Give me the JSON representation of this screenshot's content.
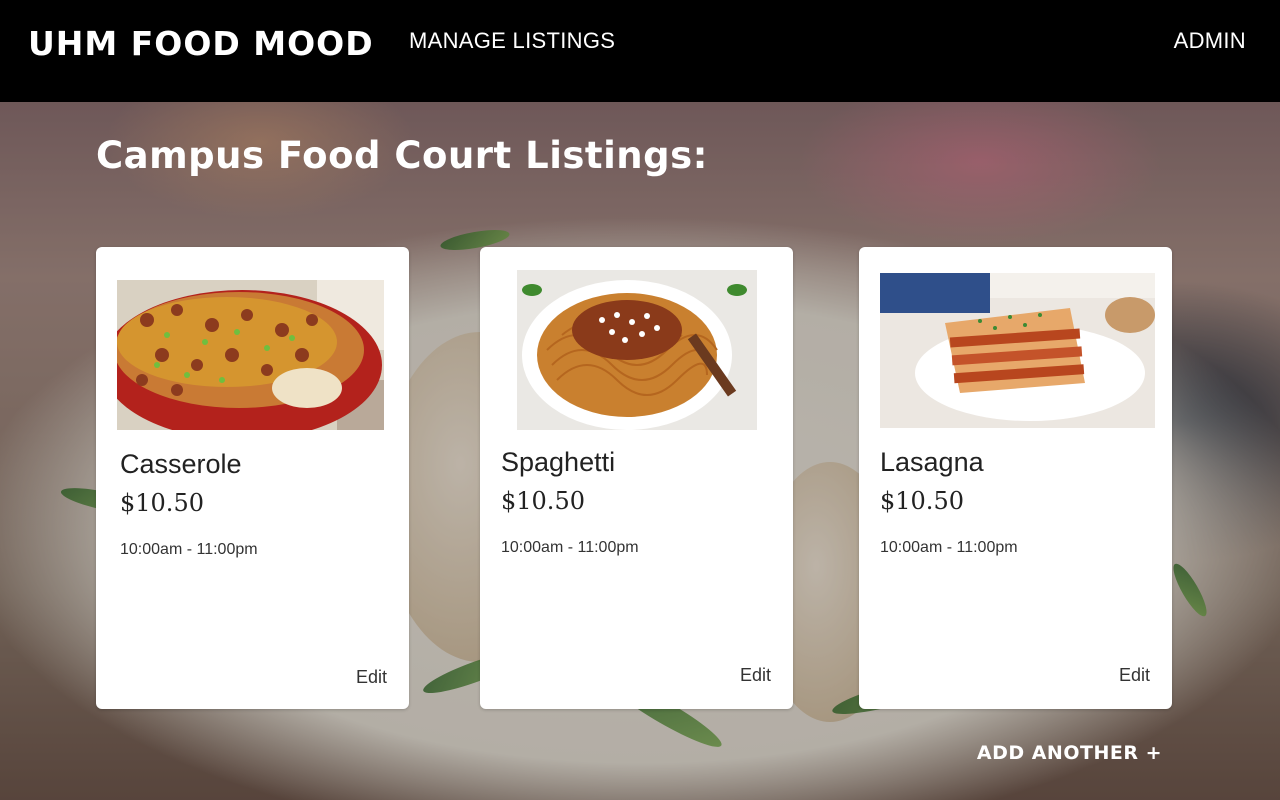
{
  "navbar": {
    "brand": "UHM FOOD MOOD",
    "manage_listings": "MANAGE LISTINGS",
    "admin": "ADMIN"
  },
  "page": {
    "title": "Campus Food Court Listings:"
  },
  "listings": [
    {
      "name": "Casserole",
      "price": "$10.50",
      "hours": "10:00am - 11:00pm",
      "edit_label": "Edit",
      "image": "casserole-photo"
    },
    {
      "name": "Spaghetti",
      "price": "$10.50",
      "hours": "10:00am - 11:00pm",
      "edit_label": "Edit",
      "image": "spaghetti-photo"
    },
    {
      "name": "Lasagna",
      "price": "$10.50",
      "hours": "10:00am - 11:00pm",
      "edit_label": "Edit",
      "image": "lasagna-photo"
    }
  ],
  "actions": {
    "add_another": "ADD ANOTHER +"
  },
  "colors": {
    "navbar_bg": "#000000",
    "card_bg": "#ffffff",
    "text_light": "#ffffff"
  }
}
